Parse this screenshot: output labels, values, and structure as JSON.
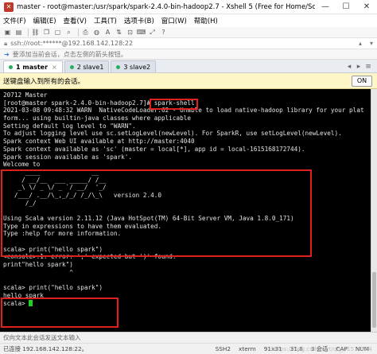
{
  "window": {
    "title": "master - root@master:/usr/spark/spark-2.4.0-bin-hadoop2.7 - Xshell 5 (Free for Home/School)",
    "controls": [
      "—",
      "☐",
      "✕"
    ]
  },
  "menu": {
    "items": [
      "文件(F)",
      "编辑(E)",
      "查看(V)",
      "工具(T)",
      "选项卡(B)",
      "窗口(W)",
      "帮助(H)"
    ]
  },
  "address": {
    "text": "ssh://root:******@192.168.142.128:22"
  },
  "hint": {
    "text": "要添加当前会话，点击左侧的箭头按钮。"
  },
  "tabs": [
    {
      "label": "1 master",
      "active": true
    },
    {
      "label": "2 slave1",
      "active": false
    },
    {
      "label": "3 slave2",
      "active": false
    }
  ],
  "inputbar": {
    "text": "送键盘输入到所有的会话。",
    "button": "ON"
  },
  "terminal": {
    "lines": [
      "20712 Master",
      "[root@master spark-2.4.0-bin-hadoop2.7]# spark-shell",
      "2021-03-08 09:48:32 WARN  NativeCodeLoader:62 - Unable to load native-hadoop library for your plat",
      "form... using builtin-java classes where applicable",
      "Setting default log level to \"WARN\".",
      "To adjust logging level use sc.setLogLevel(newLevel). For SparkR, use setLogLevel(newLevel).",
      "Spark context Web UI available at http://master:4040",
      "Spark context available as 'sc' (master = local[*], app id = local-1615168172744).",
      "Spark session available as 'spark'.",
      "Welcome to",
      "      ____              __",
      "     / __/__  ___ _____/ /__",
      "    _\\ \\/ _ \\/ _ `/ __/  '_/",
      "   /___/ .__/\\_,_/_/ /_/\\_\\   version 2.4.0",
      "      /_/",
      "",
      "Using Scala version 2.11.12 (Java HotSpot(TM) 64-Bit Server VM, Java 1.8.0_171)",
      "Type in expressions to have them evaluated.",
      "Type :help for more information.",
      "",
      "scala> print(\"hello spark\")",
      "<console>:1: error: ';' expected but ')' found.",
      "print\"hello spark\")",
      "                  ^",
      "",
      "scala> print(\"hello spark\")",
      "hello spark",
      "scala> "
    ]
  },
  "status": {
    "text": "仅向文本此会话发送文本输入"
  },
  "bottom": {
    "host": "已连接 192.168.142.128:22。",
    "protocol": "SSH2",
    "term": "xterm",
    "size": "91x31",
    "pos": "31,8",
    "sessions": "3 会话",
    "caps": "CAP",
    "num": "NUM"
  },
  "watermark": {
    "text": "https://blog.csdn.net/qq_41514794"
  },
  "colors": {
    "highlight": "#e0201c",
    "cursor": "#22d022",
    "terminal_bg": "#000000"
  }
}
